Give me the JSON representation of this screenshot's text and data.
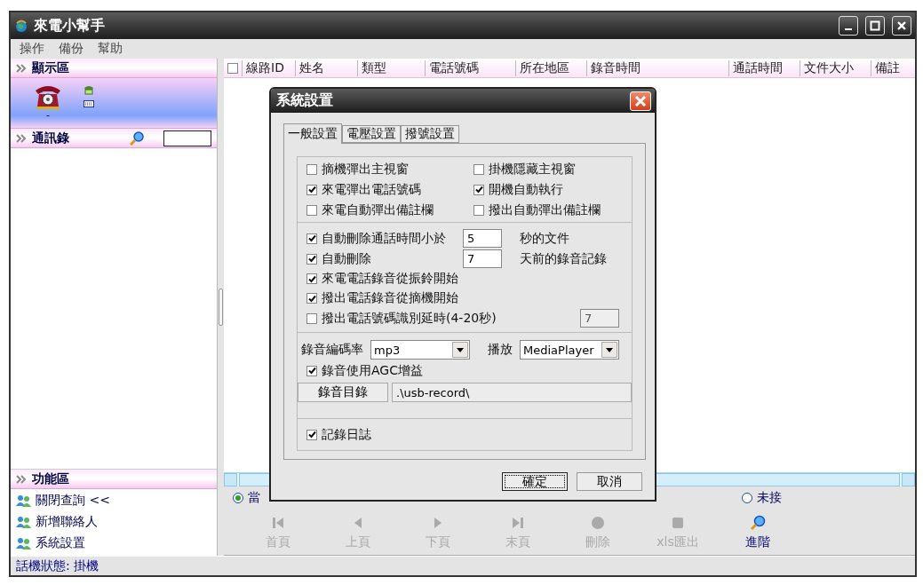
{
  "window": {
    "title": "來電小幫手"
  },
  "menu": [
    "操作",
    "備份",
    "幫助"
  ],
  "sidebar": {
    "display_section": {
      "title": "顯示區",
      "phone_status": "-"
    },
    "contacts_section": {
      "title": "通訊錄"
    },
    "function_section": {
      "title": "功能區",
      "items": [
        {
          "label": "關閉查詢 <<"
        },
        {
          "label": "新增聯絡人"
        },
        {
          "label": "系統設置"
        }
      ]
    }
  },
  "table": {
    "select_all_checked": false,
    "columns": [
      "線路ID",
      "姓名",
      "類型",
      "電話號碼",
      "所在地區",
      "錄音時間",
      "通話時間",
      "文件大小",
      "備註"
    ]
  },
  "filter": [
    {
      "label": "當",
      "selected": true
    },
    {
      "label": "未接",
      "selected": false
    }
  ],
  "toolbar": [
    {
      "label": "首頁",
      "kind": "first",
      "disabled": true
    },
    {
      "label": "上頁",
      "kind": "prev",
      "disabled": true
    },
    {
      "label": "下頁",
      "kind": "next",
      "disabled": true
    },
    {
      "label": "末頁",
      "kind": "last",
      "disabled": true
    },
    {
      "label": "刪除",
      "kind": "delete",
      "disabled": true
    },
    {
      "label": "xls匯出",
      "kind": "export",
      "disabled": true
    },
    {
      "label": "進階",
      "kind": "search",
      "disabled": false
    }
  ],
  "status_bar": "話機狀態: 掛機",
  "dialog": {
    "title": "系統設置",
    "tabs": [
      {
        "label": "一般設置",
        "selected": true
      },
      {
        "label": "電壓設置",
        "selected": false
      },
      {
        "label": "撥號設置",
        "selected": false
      }
    ],
    "window_options": [
      {
        "label": "摘機彈出主視窗",
        "checked": false
      },
      {
        "label": "掛機隱藏主視窗",
        "checked": false
      },
      {
        "label": "來電彈出電話號碼",
        "checked": true
      },
      {
        "label": "開機自動執行",
        "checked": true
      },
      {
        "label": "來電自動彈出備註欄",
        "checked": false
      },
      {
        "label": "撥出自動彈出備註欄",
        "checked": false
      }
    ],
    "auto_delete": [
      {
        "label": "自動刪除通話時間小於",
        "checked": true,
        "value": "5",
        "suffix": "秒的文件"
      },
      {
        "label": "自動刪除",
        "checked": true,
        "value": "7",
        "suffix": "天前的錄音記錄"
      }
    ],
    "recording_options": [
      {
        "label": "來電電話錄音從振鈴開始",
        "checked": true
      },
      {
        "label": "撥出電話錄音從摘機開始",
        "checked": true
      }
    ],
    "dial_delay": {
      "label": "撥出電話號碼識別延時(4-20秒)",
      "checked": false,
      "value": "7"
    },
    "encoding": {
      "label": "錄音編碼率",
      "value": "mp3"
    },
    "player": {
      "label": "播放",
      "value": "MediaPlayer"
    },
    "agc": {
      "label": "錄音使用AGC增益",
      "checked": true
    },
    "directory": {
      "button": "錄音目錄",
      "value": ".\\usb-record\\"
    },
    "log": {
      "label": "記錄日誌",
      "checked": true
    },
    "buttons": [
      {
        "label": "確定",
        "default": true
      },
      {
        "label": "取消",
        "default": false
      }
    ]
  }
}
